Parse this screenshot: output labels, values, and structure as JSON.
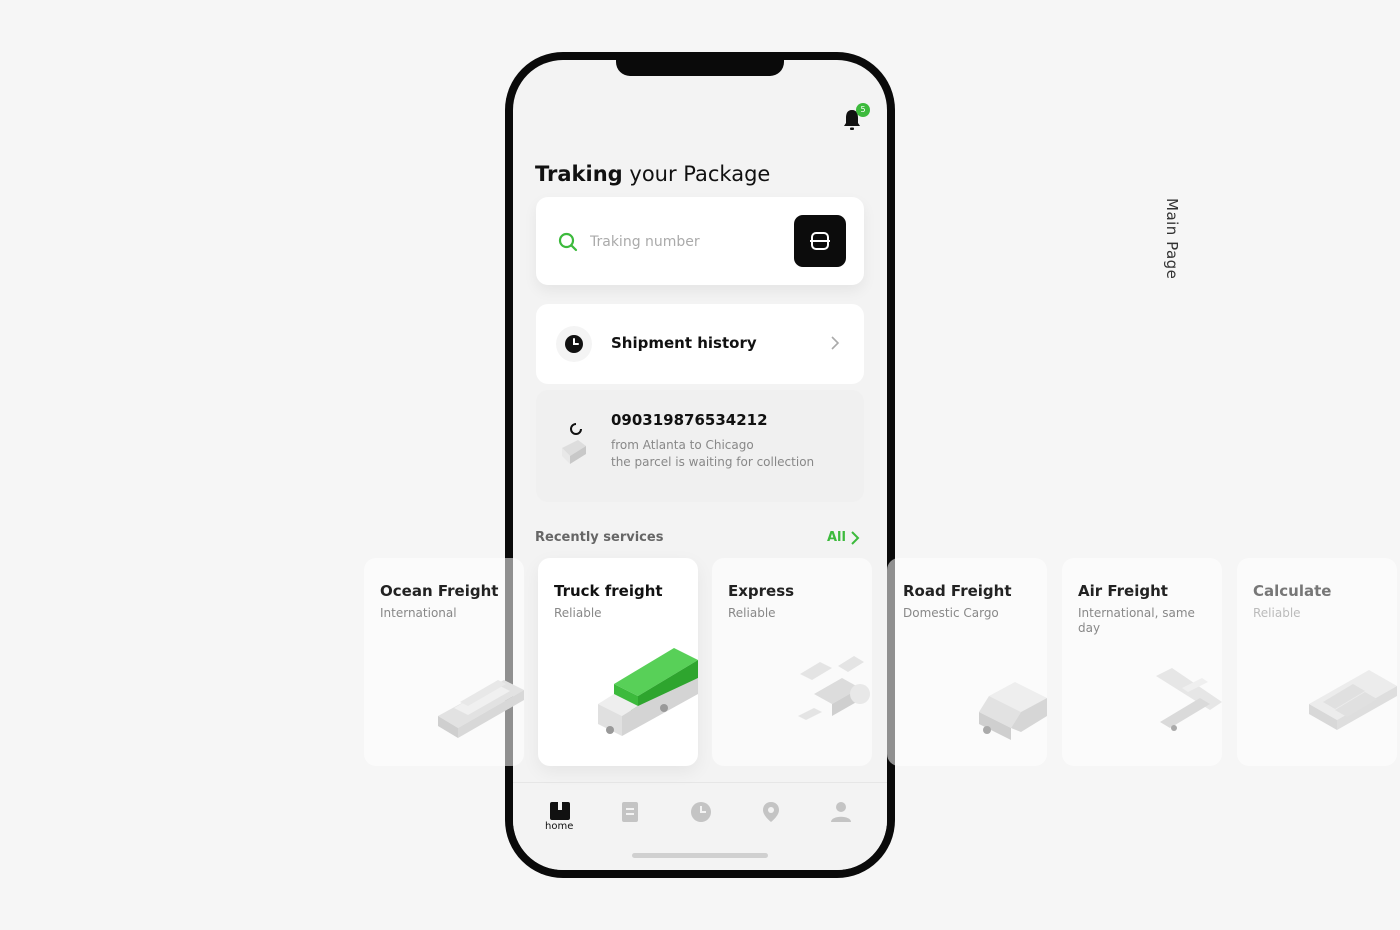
{
  "side_label": "Main Page",
  "header": {
    "notification_count": "5",
    "title_bold": "Traking",
    "title_rest": "your Package"
  },
  "search": {
    "placeholder": "Traking number"
  },
  "history": {
    "label": "Shipment history"
  },
  "parcel": {
    "number": "090319876534212",
    "route": "from Atlanta to Chicago",
    "status": "the parcel is waiting for collection"
  },
  "recent": {
    "label": "Recently services",
    "all_label": "All"
  },
  "services": [
    {
      "title": "Ocean Freight",
      "subtitle": "International",
      "icon": "ship-icon"
    },
    {
      "title": "Truck freight",
      "subtitle": "Reliable",
      "icon": "truck-icon",
      "active": true
    },
    {
      "title": "Express",
      "subtitle": "Reliable",
      "icon": "drone-icon"
    },
    {
      "title": "Road Freight",
      "subtitle": "Domestic Cargo",
      "icon": "van-icon"
    },
    {
      "title": "Air Freight",
      "subtitle": "International, same day",
      "icon": "plane-icon"
    },
    {
      "title": "Calculate",
      "subtitle": "Reliable",
      "icon": "calculator-icon"
    }
  ],
  "tabbar": {
    "home_label": "home"
  },
  "colors": {
    "accent": "#3cba3c",
    "dark": "#0c0c0c",
    "background": "#f6f6f6"
  }
}
